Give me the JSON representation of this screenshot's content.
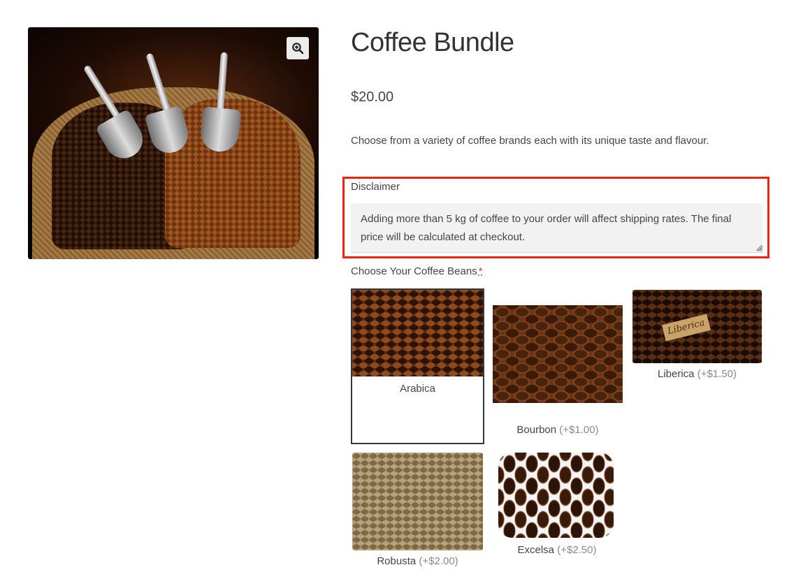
{
  "product": {
    "title": "Coffee Bundle",
    "price": "$20.00",
    "description": "Choose from a variety of coffee brands each with its unique taste and flavour.",
    "image_zoom_icon": "magnifier-plus-icon"
  },
  "disclaimer": {
    "label": "Disclaimer",
    "text": "Adding more than 5 kg of coffee to your order will affect shipping rates. The final price will be calculated at checkout.",
    "highlight_color": "#f0240d"
  },
  "beans": {
    "label": "Choose Your Coffee Beans",
    "required_marker": "*",
    "options": [
      {
        "name": "Arabica",
        "price": "",
        "selected": true
      },
      {
        "name": "Bourbon",
        "price": "(+$1.00)",
        "selected": false
      },
      {
        "name": "Liberica",
        "price": "(+$1.50)",
        "selected": false
      },
      {
        "name": "Robusta",
        "price": "(+$2.00)",
        "selected": false
      },
      {
        "name": "Excelsa",
        "price": "(+$2.50)",
        "selected": false
      }
    ],
    "liberica_tag_text": "Liberica"
  },
  "colors": {
    "text": "#43454b",
    "title": "#333333",
    "selected_border": "#2f3a45",
    "required": "#e2401c"
  }
}
